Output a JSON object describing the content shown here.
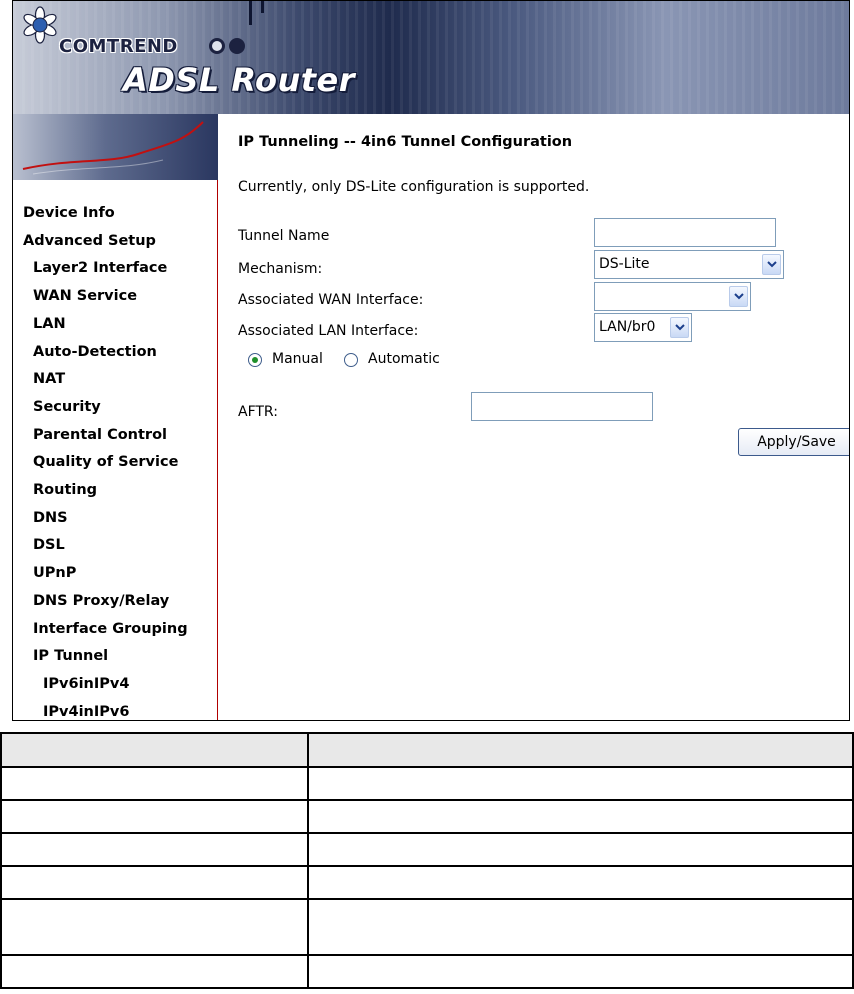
{
  "header": {
    "brand": "COMTREND",
    "product": "ADSL Router"
  },
  "sidebar": {
    "items": [
      {
        "label": "Device Info",
        "level": 0
      },
      {
        "label": "Advanced Setup",
        "level": 0
      },
      {
        "label": "Layer2 Interface",
        "level": 1
      },
      {
        "label": "WAN Service",
        "level": 1
      },
      {
        "label": "LAN",
        "level": 1
      },
      {
        "label": "Auto-Detection",
        "level": 1
      },
      {
        "label": "NAT",
        "level": 1
      },
      {
        "label": "Security",
        "level": 1
      },
      {
        "label": "Parental Control",
        "level": 1
      },
      {
        "label": "Quality of Service",
        "level": 1
      },
      {
        "label": "Routing",
        "level": 1
      },
      {
        "label": "DNS",
        "level": 1
      },
      {
        "label": "DSL",
        "level": 1
      },
      {
        "label": "UPnP",
        "level": 1
      },
      {
        "label": "DNS Proxy/Relay",
        "level": 1
      },
      {
        "label": "Interface Grouping",
        "level": 1
      },
      {
        "label": "IP Tunnel",
        "level": 1
      },
      {
        "label": "IPv6inIPv4",
        "level": 2
      },
      {
        "label": "IPv4inIPv6",
        "level": 2
      }
    ]
  },
  "main": {
    "title": "IP Tunneling -- 4in6 Tunnel Configuration",
    "note": "Currently, only DS-Lite configuration is supported.",
    "tunnel_name": {
      "label": "Tunnel Name",
      "value": ""
    },
    "mechanism": {
      "label": "Mechanism:",
      "value": "DS-Lite"
    },
    "wan_interface": {
      "label": "Associated WAN Interface:",
      "value": ""
    },
    "lan_interface": {
      "label": "Associated LAN Interface:",
      "value": "LAN/br0"
    },
    "mode": {
      "manual": "Manual",
      "automatic": "Automatic",
      "selected": "Manual"
    },
    "aftr": {
      "label": "AFTR:",
      "value": ""
    },
    "apply_label": "Apply/Save"
  },
  "desc_table": {
    "row_count": 6
  },
  "colors": {
    "sidebar_border": "#b00000",
    "input_border": "#7f9db9",
    "radio_dot": "#1f8f2a"
  }
}
